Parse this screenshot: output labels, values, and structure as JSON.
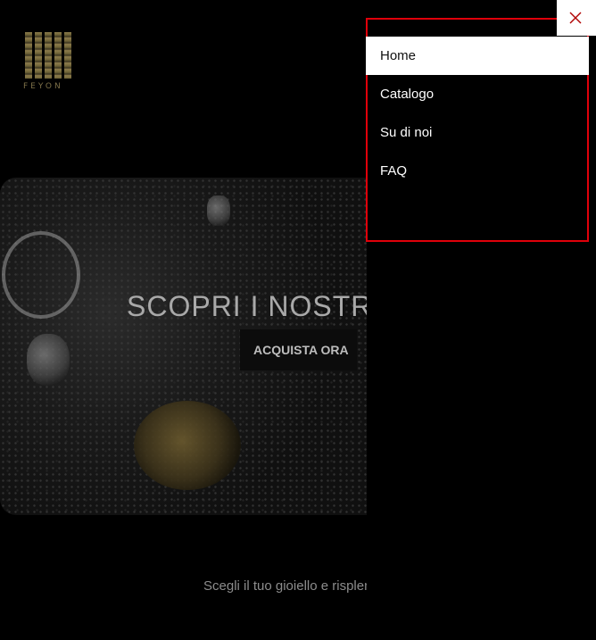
{
  "brand": {
    "name": "FEYON"
  },
  "hero": {
    "title": "SCOPRI I NOSTRI",
    "button_label": "ACQUISTA ORA"
  },
  "tagline": "Scegli il tuo gioiello e risplendi",
  "menu": {
    "close_icon": "close-icon",
    "items": [
      {
        "label": "Home",
        "active": true
      },
      {
        "label": "Catalogo",
        "active": false
      },
      {
        "label": "Su di noi",
        "active": false
      },
      {
        "label": "FAQ",
        "active": false
      }
    ]
  },
  "colors": {
    "background": "#000000",
    "highlight_border": "#e0000a",
    "active_item_bg": "#ffffff"
  }
}
